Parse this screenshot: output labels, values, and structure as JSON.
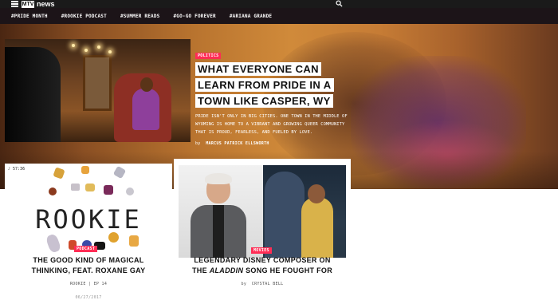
{
  "header": {
    "logo_mark": "MTV",
    "logo_text": "news"
  },
  "tags": [
    "#PRIDE MONTH",
    "#ROOKIE PODCAST",
    "#SUMMER READS",
    "#GO-GO FOREVER",
    "#ARIANA GRANDE"
  ],
  "hero": {
    "category": "POLITICS",
    "title": "WHAT EVERYONE CAN LEARN FROM PRIDE IN A TOWN LIKE CASPER, WY",
    "dek": "PRIDE ISN'T ONLY IN BIG CITIES. ONE TOWN IN THE MIDDLE OF WYOMING IS HOME TO A VIBRANT AND GROWING QUEER COMMUNITY THAT IS PROUD, FEARLESS, AND FUELED BY LOVE.",
    "byline_prefix": "by",
    "author": "MARCUS PATRICK ELLSWORTH"
  },
  "card1": {
    "audio_time": "57:36",
    "art_text": "ROOKIE",
    "category": "PODCAST",
    "title_line1": "THE GOOD KIND OF MAGICAL",
    "title_line2": "THINKING, FEAT. ROXANE GAY",
    "meta": "ROOKIE | EP 14",
    "date": "06/27/2017"
  },
  "card2": {
    "category": "MOVIES",
    "title_line1": "LEGENDARY DISNEY COMPOSER ON",
    "title_line2_a": "THE ",
    "title_line2_em": "ALADDIN",
    "title_line2_b": " SONG HE FOUGHT FOR",
    "byline": "by  CRYSTAL BELL"
  }
}
